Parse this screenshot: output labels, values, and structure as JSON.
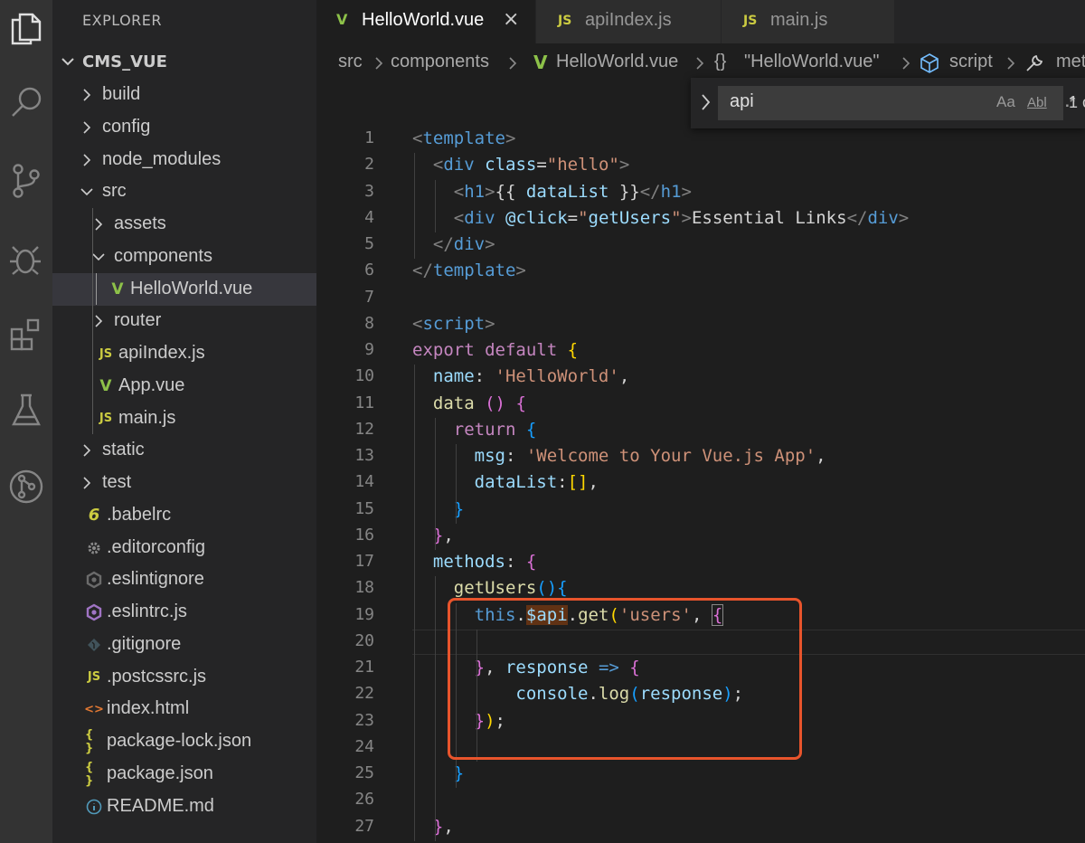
{
  "activity_bar": {
    "icons": [
      "files-icon",
      "search-icon",
      "source-control-icon",
      "debug-icon",
      "extensions-icon",
      "testing-icon",
      "git-graph-icon"
    ]
  },
  "sidebar": {
    "title": "EXPLORER",
    "folder": "CMS_VUE",
    "items": [
      {
        "label": "build",
        "kind": "folder",
        "expanded": false
      },
      {
        "label": "config",
        "kind": "folder",
        "expanded": false
      },
      {
        "label": "node_modules",
        "kind": "folder",
        "expanded": false
      },
      {
        "label": "src",
        "kind": "folder",
        "expanded": true
      },
      {
        "label": "assets",
        "kind": "folder",
        "expanded": false
      },
      {
        "label": "components",
        "kind": "folder",
        "expanded": true
      },
      {
        "label": "HelloWorld.vue",
        "kind": "vue",
        "selected": true
      },
      {
        "label": "router",
        "kind": "folder",
        "expanded": false
      },
      {
        "label": "apiIndex.js",
        "kind": "js"
      },
      {
        "label": "App.vue",
        "kind": "vue"
      },
      {
        "label": "main.js",
        "kind": "js"
      },
      {
        "label": "static",
        "kind": "folder",
        "expanded": false
      },
      {
        "label": "test",
        "kind": "folder",
        "expanded": false
      },
      {
        "label": ".babelrc",
        "kind": "babel"
      },
      {
        "label": ".editorconfig",
        "kind": "gear"
      },
      {
        "label": ".eslintignore",
        "kind": "eslint-dim"
      },
      {
        "label": ".eslintrc.js",
        "kind": "eslint"
      },
      {
        "label": ".gitignore",
        "kind": "git"
      },
      {
        "label": ".postcssrc.js",
        "kind": "js"
      },
      {
        "label": "index.html",
        "kind": "html"
      },
      {
        "label": "package-lock.json",
        "kind": "json"
      },
      {
        "label": "package.json",
        "kind": "json"
      },
      {
        "label": "README.md",
        "kind": "info"
      }
    ],
    "icon_glyphs": {
      "js": "JS",
      "vue": "V",
      "babel": "6",
      "json": "{ }",
      "html": "<>",
      "info": "i"
    }
  },
  "tabs": [
    {
      "label": "HelloWorld.vue",
      "icon": "V",
      "active": true,
      "close": "×"
    },
    {
      "label": "apiIndex.js",
      "icon": "JS",
      "active": false
    },
    {
      "label": "main.js",
      "icon": "JS",
      "active": false
    }
  ],
  "breadcrumbs": {
    "items": [
      "src",
      "components",
      "HelloWorld.vue",
      "\"HelloWorld.vue\"",
      "script",
      "met"
    ],
    "symbols": {
      "object": "{}"
    }
  },
  "find": {
    "value": "api",
    "match_case": "Aa",
    "whole_word": "Abl",
    "regex": ".*",
    "count": "1 o"
  },
  "editor": {
    "line_numbers": [
      "1",
      "2",
      "3",
      "4",
      "5",
      "6",
      "7",
      "8",
      "9",
      "10",
      "11",
      "12",
      "13",
      "14",
      "15",
      "16",
      "17",
      "18",
      "19",
      "20",
      "21",
      "22",
      "23",
      "24",
      "25",
      "26",
      "27"
    ],
    "lines": [
      [
        [
          "t-tagb",
          "<"
        ],
        [
          "t-tag",
          "template"
        ],
        [
          "t-tagb",
          ">"
        ]
      ],
      [
        [
          "t-pun",
          "  "
        ],
        [
          "t-tagb",
          "<"
        ],
        [
          "t-tag",
          "div"
        ],
        [
          "t-pun",
          " "
        ],
        [
          "t-attr",
          "class"
        ],
        [
          "t-pun",
          "="
        ],
        [
          "t-str",
          "\"hello\""
        ],
        [
          "t-tagb",
          ">"
        ]
      ],
      [
        [
          "t-pun",
          "    "
        ],
        [
          "t-tagb",
          "<"
        ],
        [
          "t-tag",
          "h1"
        ],
        [
          "t-tagb",
          ">"
        ],
        [
          "t-pun",
          "{{ "
        ],
        [
          "t-var",
          "dataList"
        ],
        [
          "t-pun",
          " }}"
        ],
        [
          "t-tagb",
          "</"
        ],
        [
          "t-tag",
          "h1"
        ],
        [
          "t-tagb",
          ">"
        ]
      ],
      [
        [
          "t-pun",
          "    "
        ],
        [
          "t-tagb",
          "<"
        ],
        [
          "t-tag",
          "div"
        ],
        [
          "t-pun",
          " "
        ],
        [
          "t-attr",
          "@click"
        ],
        [
          "t-pun",
          "="
        ],
        [
          "t-str",
          "\""
        ],
        [
          "t-var",
          "getUsers"
        ],
        [
          "t-str",
          "\""
        ],
        [
          "t-tagb",
          ">"
        ],
        [
          "t-pun",
          "Essential Links"
        ],
        [
          "t-tagb",
          "</"
        ],
        [
          "t-tag",
          "div"
        ],
        [
          "t-tagb",
          ">"
        ]
      ],
      [
        [
          "t-pun",
          "  "
        ],
        [
          "t-tagb",
          "</"
        ],
        [
          "t-tag",
          "div"
        ],
        [
          "t-tagb",
          ">"
        ]
      ],
      [
        [
          "t-tagb",
          "</"
        ],
        [
          "t-tag",
          "template"
        ],
        [
          "t-tagb",
          ">"
        ]
      ],
      [],
      [
        [
          "t-tagb",
          "<"
        ],
        [
          "t-tag",
          "script"
        ],
        [
          "t-tagb",
          ">"
        ]
      ],
      [
        [
          "t-kw",
          "export"
        ],
        [
          "t-pun",
          " "
        ],
        [
          "t-kw",
          "default"
        ],
        [
          "t-pun",
          " "
        ],
        [
          "t-brk1",
          "{"
        ]
      ],
      [
        [
          "t-pun",
          "  "
        ],
        [
          "t-var",
          "name"
        ],
        [
          "t-pun",
          ": "
        ],
        [
          "t-str",
          "'HelloWorld'"
        ],
        [
          "t-pun",
          ","
        ]
      ],
      [
        [
          "t-pun",
          "  "
        ],
        [
          "t-fn",
          "data"
        ],
        [
          "t-pun",
          " "
        ],
        [
          "t-brk2",
          "()"
        ],
        [
          "t-pun",
          " "
        ],
        [
          "t-brk2",
          "{"
        ]
      ],
      [
        [
          "t-pun",
          "    "
        ],
        [
          "t-kw",
          "return"
        ],
        [
          "t-pun",
          " "
        ],
        [
          "t-brk3",
          "{"
        ]
      ],
      [
        [
          "t-pun",
          "      "
        ],
        [
          "t-var",
          "msg"
        ],
        [
          "t-pun",
          ": "
        ],
        [
          "t-str",
          "'Welcome to Your Vue.js App'"
        ],
        [
          "t-pun",
          ","
        ]
      ],
      [
        [
          "t-pun",
          "      "
        ],
        [
          "t-var",
          "dataList"
        ],
        [
          "t-pun",
          ":"
        ],
        [
          "t-brk1",
          "[]"
        ],
        [
          "t-pun",
          ","
        ]
      ],
      [
        [
          "t-pun",
          "    "
        ],
        [
          "t-brk3",
          "}"
        ]
      ],
      [
        [
          "t-pun",
          "  "
        ],
        [
          "t-brk2",
          "}"
        ],
        [
          "t-pun",
          ","
        ]
      ],
      [
        [
          "t-pun",
          "  "
        ],
        [
          "t-var",
          "methods"
        ],
        [
          "t-pun",
          ": "
        ],
        [
          "t-brk2",
          "{"
        ]
      ],
      [
        [
          "t-pun",
          "    "
        ],
        [
          "t-fn",
          "getUsers"
        ],
        [
          "t-brk3",
          "()"
        ],
        [
          "t-brk3",
          "{"
        ]
      ],
      [
        [
          "t-pun",
          "      "
        ],
        [
          "t-this",
          "this"
        ],
        [
          "t-pun",
          "."
        ],
        [
          "t-var t-hl",
          "$"
        ],
        [
          "t-var t-hl",
          "api"
        ],
        [
          "t-pun",
          "."
        ],
        [
          "t-fn",
          "get"
        ],
        [
          "t-brk1",
          "("
        ],
        [
          "t-str",
          "'users'"
        ],
        [
          "t-pun",
          ", "
        ],
        [
          "t-brk2 t-match",
          "{"
        ]
      ],
      [],
      [
        [
          "t-pun",
          "      "
        ],
        [
          "t-brk2",
          "}"
        ],
        [
          "t-pun",
          ", "
        ],
        [
          "t-var",
          "response"
        ],
        [
          "t-pun",
          " "
        ],
        [
          "t-tag",
          "=>"
        ],
        [
          "t-pun",
          " "
        ],
        [
          "t-brk2",
          "{"
        ]
      ],
      [
        [
          "t-pun",
          "          "
        ],
        [
          "t-var",
          "console"
        ],
        [
          "t-pun",
          "."
        ],
        [
          "t-fn",
          "log"
        ],
        [
          "t-brk3",
          "("
        ],
        [
          "t-var",
          "response"
        ],
        [
          "t-brk3",
          ")"
        ],
        [
          "t-pun",
          ";"
        ]
      ],
      [
        [
          "t-pun",
          "      "
        ],
        [
          "t-brk2",
          "}"
        ],
        [
          "t-brk1",
          ")"
        ],
        [
          "t-pun",
          ";"
        ]
      ],
      [],
      [
        [
          "t-pun",
          "    "
        ],
        [
          "t-brk3",
          "}"
        ]
      ],
      [],
      [
        [
          "t-pun",
          "  "
        ],
        [
          "t-brk2",
          "}"
        ],
        [
          "t-pun",
          ","
        ]
      ]
    ]
  },
  "colors": {
    "annotation_box": "#e8542c",
    "js_icon": "#cbcb41",
    "vue_icon": "#8dc149"
  }
}
